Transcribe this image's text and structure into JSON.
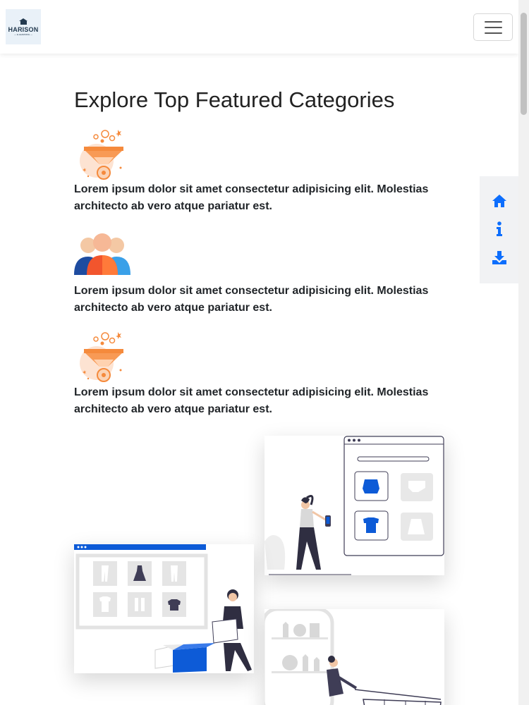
{
  "header": {
    "logo": {
      "brand": "HARISON",
      "tagline": "— E-LEARNING —"
    },
    "menu_toggle_icon": "hamburger-icon"
  },
  "main": {
    "title": "Explore Top Featured Categories",
    "features": [
      {
        "icon": "funnel-icon",
        "text": "Lorem ipsum dolor sit amet consectetur adipisicing elit. Molestias architecto ab vero atque pariatur est."
      },
      {
        "icon": "users-group-icon",
        "text": "Lorem ipsum dolor sit amet consectetur adipisicing elit. Molestias architecto ab vero atque pariatur est."
      },
      {
        "icon": "funnel-icon",
        "text": "Lorem ipsum dolor sit amet consectetur adipisicing elit. Molestias architecto ab vero atque pariatur est."
      }
    ],
    "gallery": [
      {
        "illustration": "shopping-app-illustration"
      },
      {
        "illustration": "online-store-illustration"
      },
      {
        "illustration": "grocery-cart-illustration"
      }
    ]
  },
  "side_menu": {
    "items": [
      {
        "icon": "home-icon"
      },
      {
        "icon": "info-icon"
      },
      {
        "icon": "download-icon"
      }
    ]
  },
  "colors": {
    "accent": "#0d6efd",
    "funnel": "#f58a3c",
    "users_dark": "#1e3a8a",
    "side_menu_bg": "#f1f2f4"
  }
}
